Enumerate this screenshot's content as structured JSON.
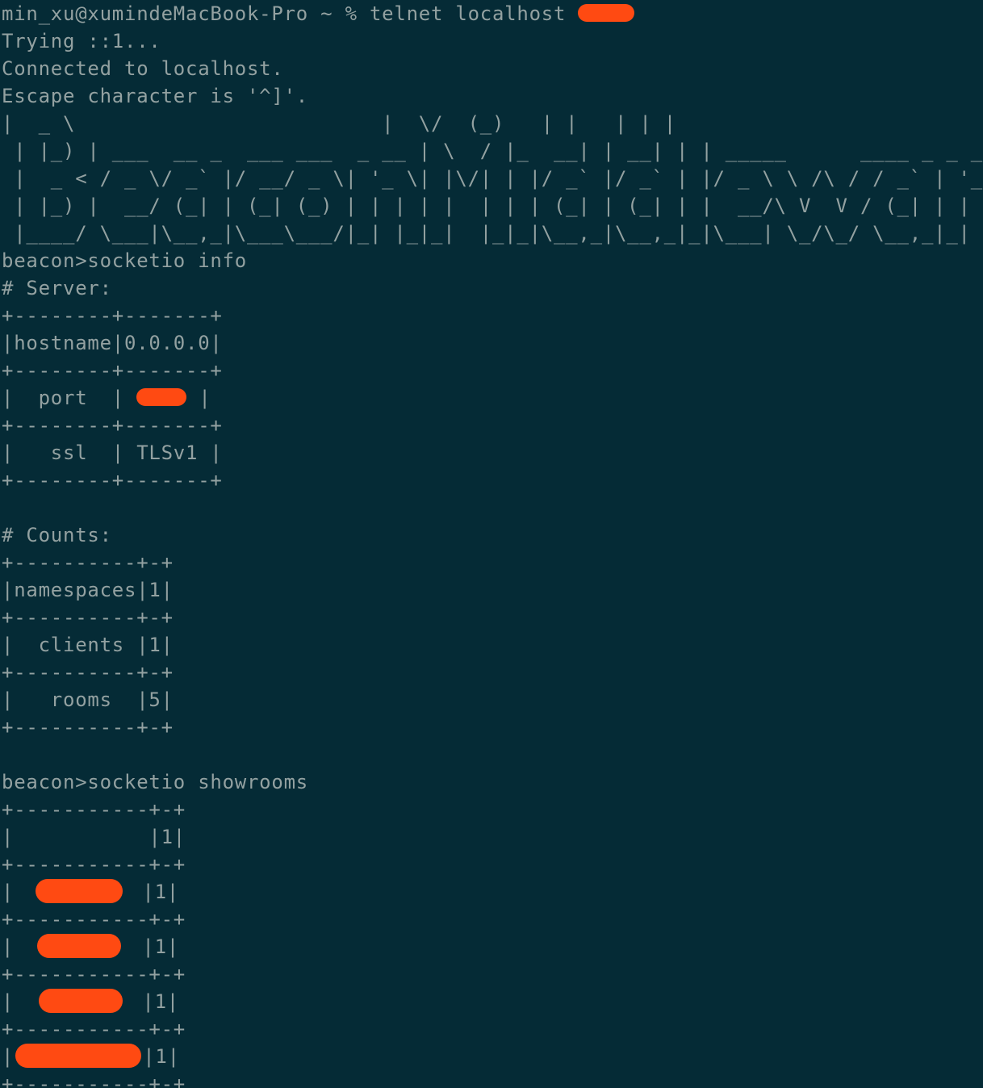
{
  "terminal": {
    "prompt_line": "min_xu@xumindeMacBook-Pro ~ % telnet localhost ",
    "trying": "Trying ::1...",
    "connected": "Connected to localhost.",
    "escape": "Escape character is '^]'.",
    "banner": [
      "|  _ \\                         |  \\/  (_)   | |   | | |",
      " | |_) | ___  __ _  ___ ___  _ __ | \\  / |_  __| | __| | | _____      ____ _ _ __ ___",
      " |  _ < / _ \\/ _` |/ __/ _ \\| '_ \\| |\\/| | |/ _` |/ _` | |/ _ \\ \\ /\\ / / _` | '__/ _ \\",
      " | |_) |  __/ (_| | (_| (_) | | | | |  | | | (_| | (_| | |  __/\\ V  V / (_| | | |  __/",
      " |____/ \\___|\\__,_|\\___\\___/|_| |_|_|  |_|_|\\__,_|\\__,_|_|\\___| \\_/\\_/ \\__,_|_|  \\___|"
    ],
    "cmd_info": "beacon>socketio info",
    "server_heading": "# Server:",
    "server_table": {
      "border": "+--------+-------+",
      "rows": [
        {
          "key": "|hostname|0.0.0.0|"
        },
        {
          "key": "|  port  | ",
          "suffix": " |"
        },
        {
          "key": "|   ssl  | TLSv1 |"
        }
      ]
    },
    "counts_heading": "# Counts:",
    "counts_table": {
      "border": "+----------+-+",
      "rows": [
        "|namespaces|1|",
        "|  clients |1|",
        "|   rooms  |5|"
      ]
    },
    "cmd_showrooms": "beacon>socketio showrooms",
    "rooms_table": {
      "border": "+-----------+-+",
      "first_row": "|           |1|",
      "row_prefix": "| ",
      "row_suffix": "|1|",
      "last_row_prefix": "|",
      "last_row_suffix": "|1|"
    }
  },
  "colors": {
    "background": "#052b36",
    "text": "#93a1a1",
    "redaction": "#ff4a12"
  }
}
